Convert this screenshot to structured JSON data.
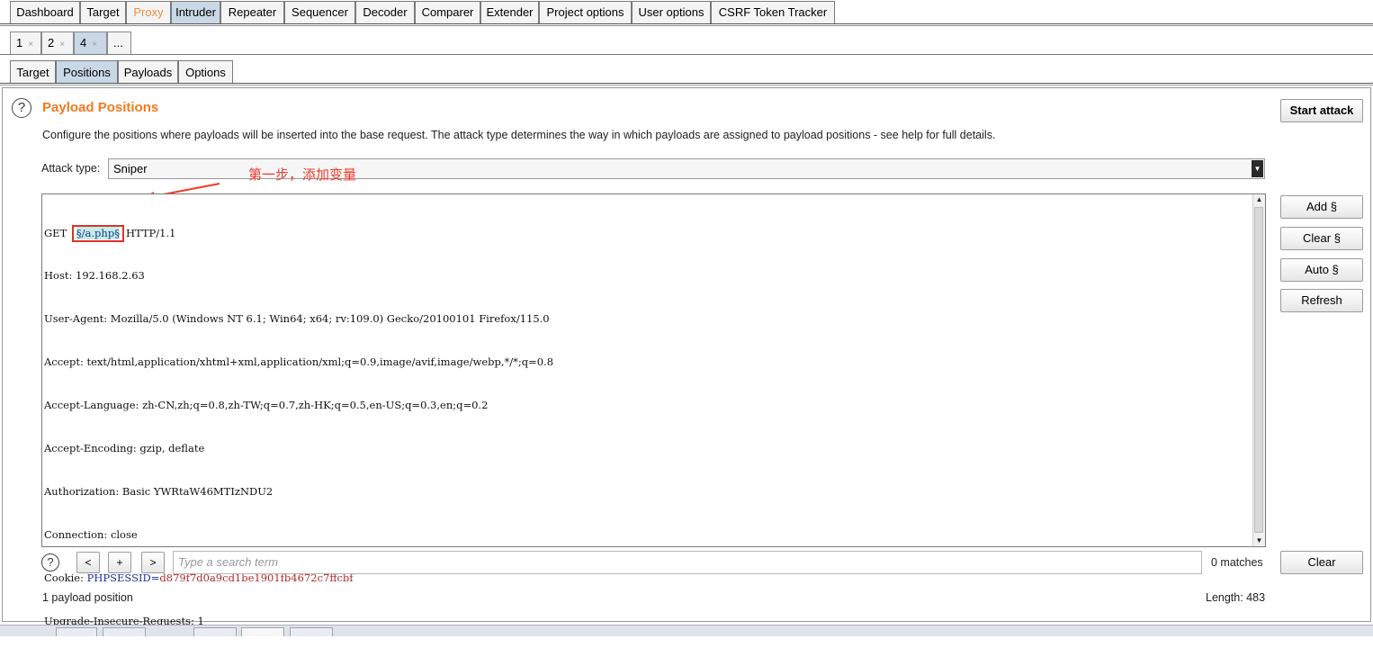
{
  "top_tabs": [
    "Dashboard",
    "Target",
    "Proxy",
    "Intruder",
    "Repeater",
    "Sequencer",
    "Decoder",
    "Comparer",
    "Extender",
    "Project options",
    "User options",
    "CSRF Token Tracker"
  ],
  "number_tabs": [
    {
      "label": "1",
      "close": "×"
    },
    {
      "label": "2",
      "close": "×"
    },
    {
      "label": "4",
      "close": "×"
    },
    {
      "label": "..."
    }
  ],
  "sub_tabs": [
    "Target",
    "Positions",
    "Payloads",
    "Options"
  ],
  "section": {
    "help_glyph": "?",
    "title": "Payload Positions",
    "description": "Configure the positions where payloads will be inserted into the base request. The attack type determines the way in which payloads are assigned to payload positions - see help for full details."
  },
  "start_attack": "Start attack",
  "attack_type": {
    "label": "Attack type:",
    "value": "Sniper",
    "arrow": "▼"
  },
  "annotation": "第一步，添加变量",
  "request": {
    "l1_pre": "GET ",
    "l1_marker": "§/a.php§",
    "l1_post": "HTTP/1.1",
    "l2": "Host: 192.168.2.63",
    "l3": "User-Agent: Mozilla/5.0 (Windows NT 6.1; Win64; x64; rv:109.0) Gecko/20100101 Firefox/115.0",
    "l4": "Accept: text/html,application/xhtml+xml,application/xml;q=0.9,image/avif,image/webp,*/*;q=0.8",
    "l5": "Accept-Language: zh-CN,zh;q=0.8,zh-TW;q=0.7,zh-HK;q=0.5,en-US;q=0.3,en;q=0.2",
    "l6": "Accept-Encoding: gzip, deflate",
    "l7": "Authorization: Basic YWRtaW46MTIzNDU2",
    "l8": "Connection: close",
    "l9_key": "Cookie: ",
    "l9_name": "PHPSESSID",
    "l9_eq": "=",
    "l9_value": "d879f7d0a9cd1be1901fb4672c7ffcbf",
    "l10": "Upgrade-Insecure-Requests: 1"
  },
  "side_buttons": {
    "add": "Add §",
    "clear": "Clear §",
    "auto": "Auto §",
    "refresh": "Refresh"
  },
  "search": {
    "prev": "<",
    "plus": "+",
    "next": ">",
    "placeholder": "Type a search term",
    "matches": "0 matches",
    "clear": "Clear",
    "help_glyph": "?"
  },
  "footer": {
    "positions": "1 payload position",
    "length": "Length: 483"
  },
  "colors": {
    "accent_orange": "#f07a22",
    "active_tab": "#c9d8e6",
    "annotation_red": "#f03a2a"
  }
}
